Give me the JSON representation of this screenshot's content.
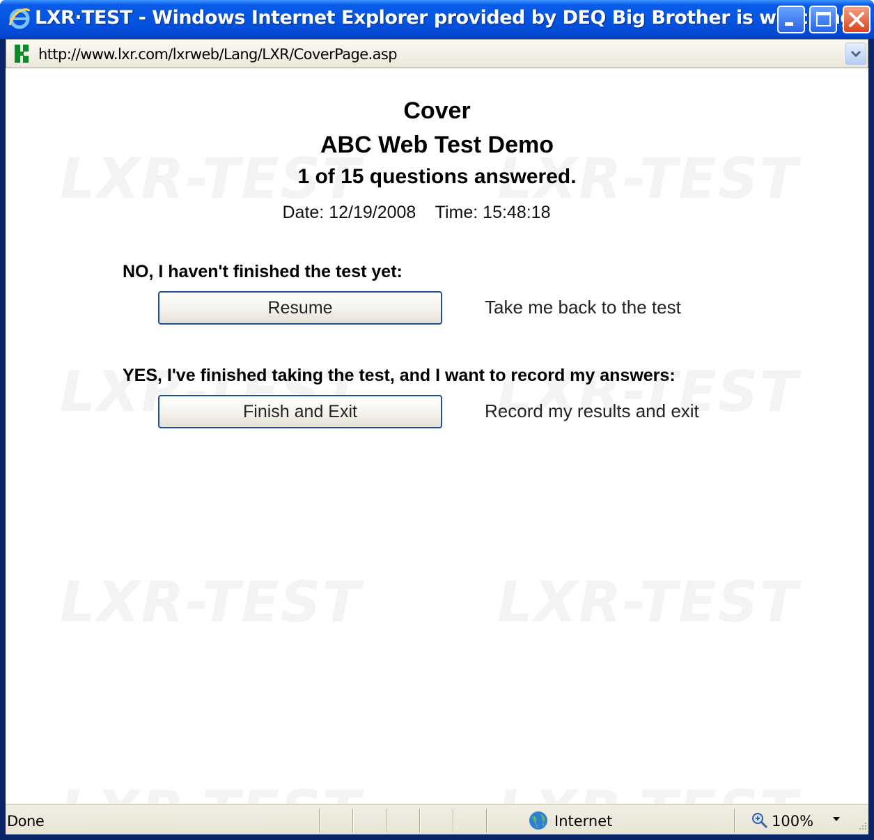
{
  "window": {
    "title": "LXR·TEST - Windows Internet Explorer provided by DEQ Big Brother is watching",
    "icon": "ie-icon",
    "buttons": [
      "minimize-icon",
      "maximize-icon",
      "close-icon"
    ]
  },
  "address": {
    "url": "http://www.lxr.com/lxrweb/Lang/LXR/CoverPage.asp"
  },
  "watermark": "LXR-TEST",
  "page": {
    "title": "Cover",
    "test_name": "ABC Web Test Demo",
    "progress": "1 of 15 questions answered.",
    "date_line": "Date: 12/19/2008    Time: 15:48:18"
  },
  "resume_section": {
    "prompt": "NO, I haven't finished the test yet:",
    "button_label": "Resume",
    "description": "Take me back to the test"
  },
  "finish_section": {
    "prompt": "YES, I've finished taking the test, and I want to record my answers:",
    "button_label": "Finish and Exit",
    "description": "Record my results and exit"
  },
  "status": {
    "text": "Done",
    "zone": "Internet",
    "zoom": "100%"
  },
  "colors": {
    "titlebar": "#0454e2",
    "close_button": "#d9441a",
    "button_border": "#1f4f99"
  }
}
